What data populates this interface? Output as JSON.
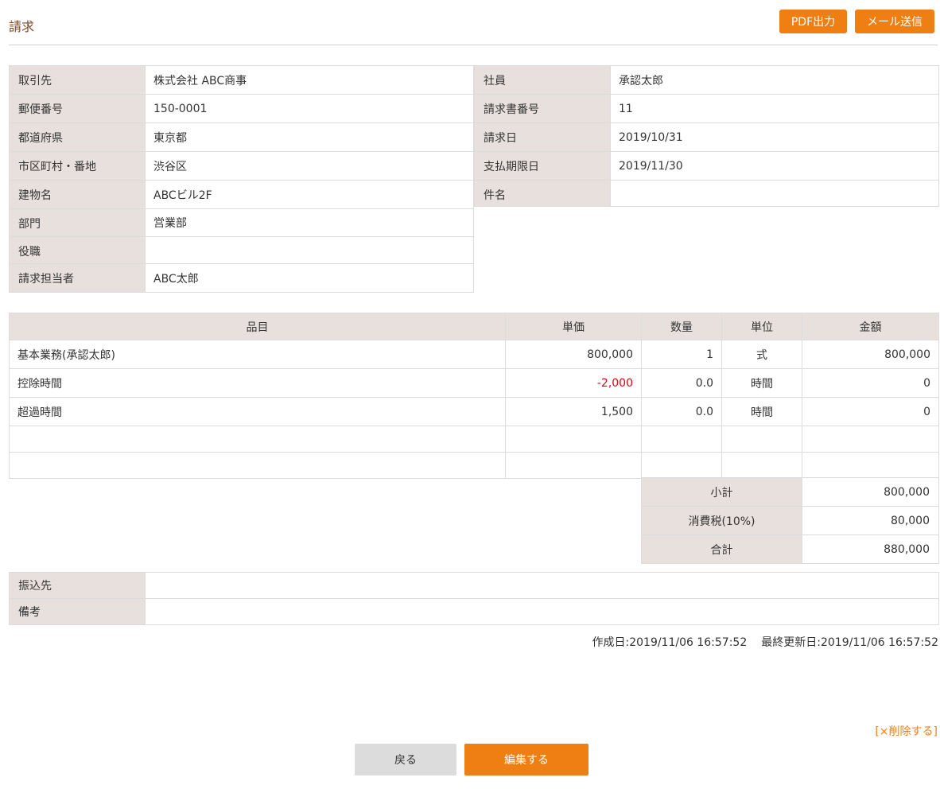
{
  "page": {
    "title": "請求",
    "pdf_button": "PDF出力",
    "mail_button": "メール送信"
  },
  "client": [
    {
      "label": "取引先",
      "value": "株式会社 ABC商事"
    },
    {
      "label": "郵便番号",
      "value": "150-0001"
    },
    {
      "label": "都道府県",
      "value": "東京都"
    },
    {
      "label": "市区町村・番地",
      "value": "渋谷区"
    },
    {
      "label": "建物名",
      "value": "ABCビル2F"
    },
    {
      "label": "部門",
      "value": "営業部"
    },
    {
      "label": "役職",
      "value": ""
    },
    {
      "label": "請求担当者",
      "value": "ABC太郎"
    }
  ],
  "invoice": [
    {
      "label": "社員",
      "value": "承認太郎"
    },
    {
      "label": "請求書番号",
      "value": "11"
    },
    {
      "label": "請求日",
      "value": "2019/10/31"
    },
    {
      "label": "支払期限日",
      "value": "2019/11/30"
    },
    {
      "label": "件名",
      "value": ""
    }
  ],
  "items": {
    "headers": [
      "品目",
      "単価",
      "数量",
      "単位",
      "金額"
    ],
    "rows": [
      {
        "name": "基本業務(承認太郎)",
        "price": "800,000",
        "qty": "1",
        "unit": "式",
        "amount": "800,000"
      },
      {
        "name": "控除時間",
        "price": "-2,000",
        "qty": "0.0",
        "unit": "時間",
        "amount": "0"
      },
      {
        "name": "超過時間",
        "price": "1,500",
        "qty": "0.0",
        "unit": "時間",
        "amount": "0"
      }
    ]
  },
  "totals": [
    {
      "label": "小計",
      "value": "800,000"
    },
    {
      "label": "消費税(10%)",
      "value": "80,000"
    },
    {
      "label": "合計",
      "value": "880,000"
    }
  ],
  "extra": [
    {
      "label": "振込先",
      "value": ""
    },
    {
      "label": "備考",
      "value": ""
    }
  ],
  "footer": {
    "created": "作成日:2019/11/06 16:57:52",
    "updated": "最終更新日:2019/11/06 16:57:52",
    "delete_link": "[×削除する]",
    "back_button": "戻る",
    "edit_button": "編集する"
  },
  "colors": {
    "accent": "#f07f13",
    "label_bg": "#e8e0dd",
    "negative": "#e60012"
  }
}
